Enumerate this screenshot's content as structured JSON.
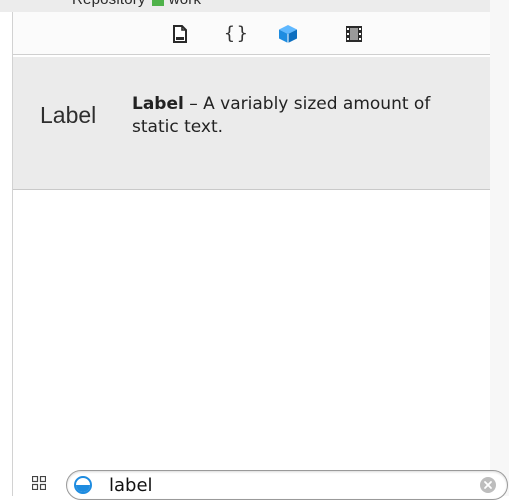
{
  "top_strip": {
    "partial_text_left": "Repository",
    "partial_text_right": "work"
  },
  "tabs": [
    {
      "icon": "file-template-icon"
    },
    {
      "icon": "code-snippet-icon",
      "glyph": "{}"
    },
    {
      "icon": "object-library-icon",
      "selected": true,
      "color": "#1e8ce0"
    },
    {
      "icon": "media-library-icon"
    }
  ],
  "result": {
    "preview_text": "Label",
    "title": "Label",
    "description": " – A variably sized amount of static text."
  },
  "search": {
    "value": "label",
    "placeholder": ""
  },
  "colors": {
    "accent": "#1e8ce0",
    "row_bg": "#ebebeb",
    "swatch": "#4fb24a"
  }
}
